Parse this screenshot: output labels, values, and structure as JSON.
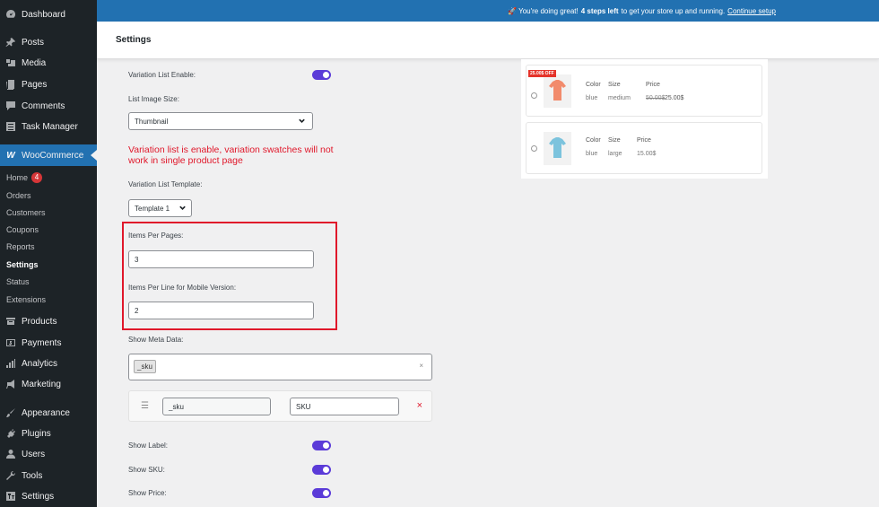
{
  "sidebar": {
    "items": [
      {
        "label": "Dashboard",
        "icon": "dashboard-icon"
      },
      {
        "label": "Posts",
        "icon": "pin-icon"
      },
      {
        "label": "Media",
        "icon": "media-icon"
      },
      {
        "label": "Pages",
        "icon": "page-icon"
      },
      {
        "label": "Comments",
        "icon": "comment-icon"
      },
      {
        "label": "Task Manager",
        "icon": "list-icon"
      },
      {
        "label": "WooCommerce",
        "icon": "woo-icon"
      },
      {
        "label": "Products",
        "icon": "archive-icon"
      },
      {
        "label": "Payments",
        "icon": "dollar-icon"
      },
      {
        "label": "Analytics",
        "icon": "bar-chart-icon"
      },
      {
        "label": "Marketing",
        "icon": "megaphone-icon"
      },
      {
        "label": "Appearance",
        "icon": "brush-icon"
      },
      {
        "label": "Plugins",
        "icon": "plug-icon"
      },
      {
        "label": "Users",
        "icon": "user-icon"
      },
      {
        "label": "Tools",
        "icon": "wrench-icon"
      },
      {
        "label": "Settings",
        "icon": "settings-icon"
      }
    ],
    "woo_submenu": [
      {
        "label": "Home",
        "badge": "4"
      },
      {
        "label": "Orders"
      },
      {
        "label": "Customers"
      },
      {
        "label": "Coupons"
      },
      {
        "label": "Reports"
      },
      {
        "label": "Settings"
      },
      {
        "label": "Status"
      },
      {
        "label": "Extensions"
      }
    ]
  },
  "notice": {
    "prefix": "🚀 You're doing great!",
    "bold": "4 steps left",
    "suffix": "to get your store up and running.",
    "link": "Continue setup"
  },
  "page_title": "Settings",
  "form": {
    "variation_list_enable_label": "Variation List Enable:",
    "variation_list_enable": true,
    "list_image_size_label": "List Image Size:",
    "list_image_size_value": "Thumbnail",
    "warning": "Variation list is enable, variation swatches will not work in single product page",
    "template_label": "Variation List Template:",
    "template_value": "Template 1",
    "items_per_pages_label": "Items Per Pages:",
    "items_per_pages_value": "3",
    "items_per_line_mobile_label": "Items Per Line for Mobile Version:",
    "items_per_line_mobile_value": "2",
    "show_meta_label": "Show Meta Data:",
    "meta_tag": "_sku",
    "meta_clear": "×",
    "mapping_key": "_sku",
    "mapping_label": "SKU",
    "mapping_delete": "×",
    "mapping_drag": "☰",
    "show_label_label": "Show Label:",
    "show_sku_label": "Show SKU:",
    "show_price_label": "Show Price:",
    "show_label": true,
    "show_sku": true,
    "show_price": true
  },
  "preview": {
    "rows": [
      {
        "badge": "25.00$ OFF",
        "color_h": "Color",
        "size_h": "Size",
        "price_h": "Price",
        "color": "blue",
        "size": "medium",
        "old_price": "50.00$",
        "price": "25.00$",
        "shirt_color": "#f28b6c"
      },
      {
        "badge": "",
        "color_h": "Color",
        "size_h": "Size",
        "price_h": "Price",
        "color": "blue",
        "size": "large",
        "old_price": "",
        "price": "15.00$",
        "shirt_color": "#7cc3dd"
      }
    ]
  },
  "colors": {
    "accent": "#2271b1",
    "toggle": "#5b3bd8",
    "warning": "#e0182b",
    "sidebar": "#1d2327"
  }
}
